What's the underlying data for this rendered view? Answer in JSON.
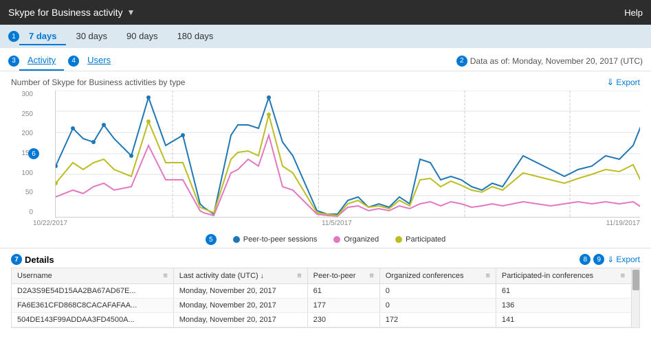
{
  "header": {
    "title": "Skype for Business activity",
    "help_label": "Help"
  },
  "time_filter": {
    "badge": "1",
    "options": [
      "7 days",
      "30 days",
      "90 days",
      "180 days"
    ],
    "active": "7 days"
  },
  "tabs": {
    "badge3": "3",
    "badge4": "4",
    "items": [
      "Activity",
      "Users"
    ],
    "active": "Activity"
  },
  "data_as_of": {
    "badge": "2",
    "text": "Data as of: Monday, November 20, 2017 (UTC)"
  },
  "chart": {
    "title": "Number of Skype for Business activities by type",
    "export_label": "Export",
    "y_labels": [
      "300",
      "250",
      "200",
      "150",
      "100",
      "50",
      "0"
    ],
    "x_labels": [
      "10/22/2017",
      "",
      "11/5/2017",
      "",
      "11/19/2017"
    ],
    "badge6": "6"
  },
  "legend": {
    "badge": "5",
    "items": [
      {
        "label": "Peer-to-peer sessions",
        "color": "#1f77b4"
      },
      {
        "label": "Organized",
        "color": "#e377c2"
      },
      {
        "label": "Participated",
        "color": "#bcbd22"
      }
    ]
  },
  "details": {
    "badge7": "7",
    "title": "Details",
    "badge8": "8",
    "badge9": "9",
    "export_label": "Export",
    "columns": [
      {
        "label": "Username",
        "icon": "≡"
      },
      {
        "label": "Last activity date (UTC)",
        "sort": "↓",
        "icon": "≡"
      },
      {
        "label": "Peer-to-peer",
        "icon": "≡"
      },
      {
        "label": "Organized conferences",
        "icon": "≡"
      },
      {
        "label": "Participated-in conferences",
        "icon": "≡"
      }
    ],
    "rows": [
      {
        "username": "D2A3S9E54D15AA2BA67AD67E...",
        "last_activity": "Monday, November 20, 2017",
        "peer_to_peer": "61",
        "organized": "0",
        "participated": "61"
      },
      {
        "username": "FA6E361CFD868C8CACAFAFAA...",
        "last_activity": "Monday, November 20, 2017",
        "peer_to_peer": "177",
        "organized": "0",
        "participated": "136"
      },
      {
        "username": "504DE143F99ADDAA3FD4500A...",
        "last_activity": "Monday, November 20, 2017",
        "peer_to_peer": "230",
        "organized": "172",
        "participated": "141"
      }
    ]
  }
}
